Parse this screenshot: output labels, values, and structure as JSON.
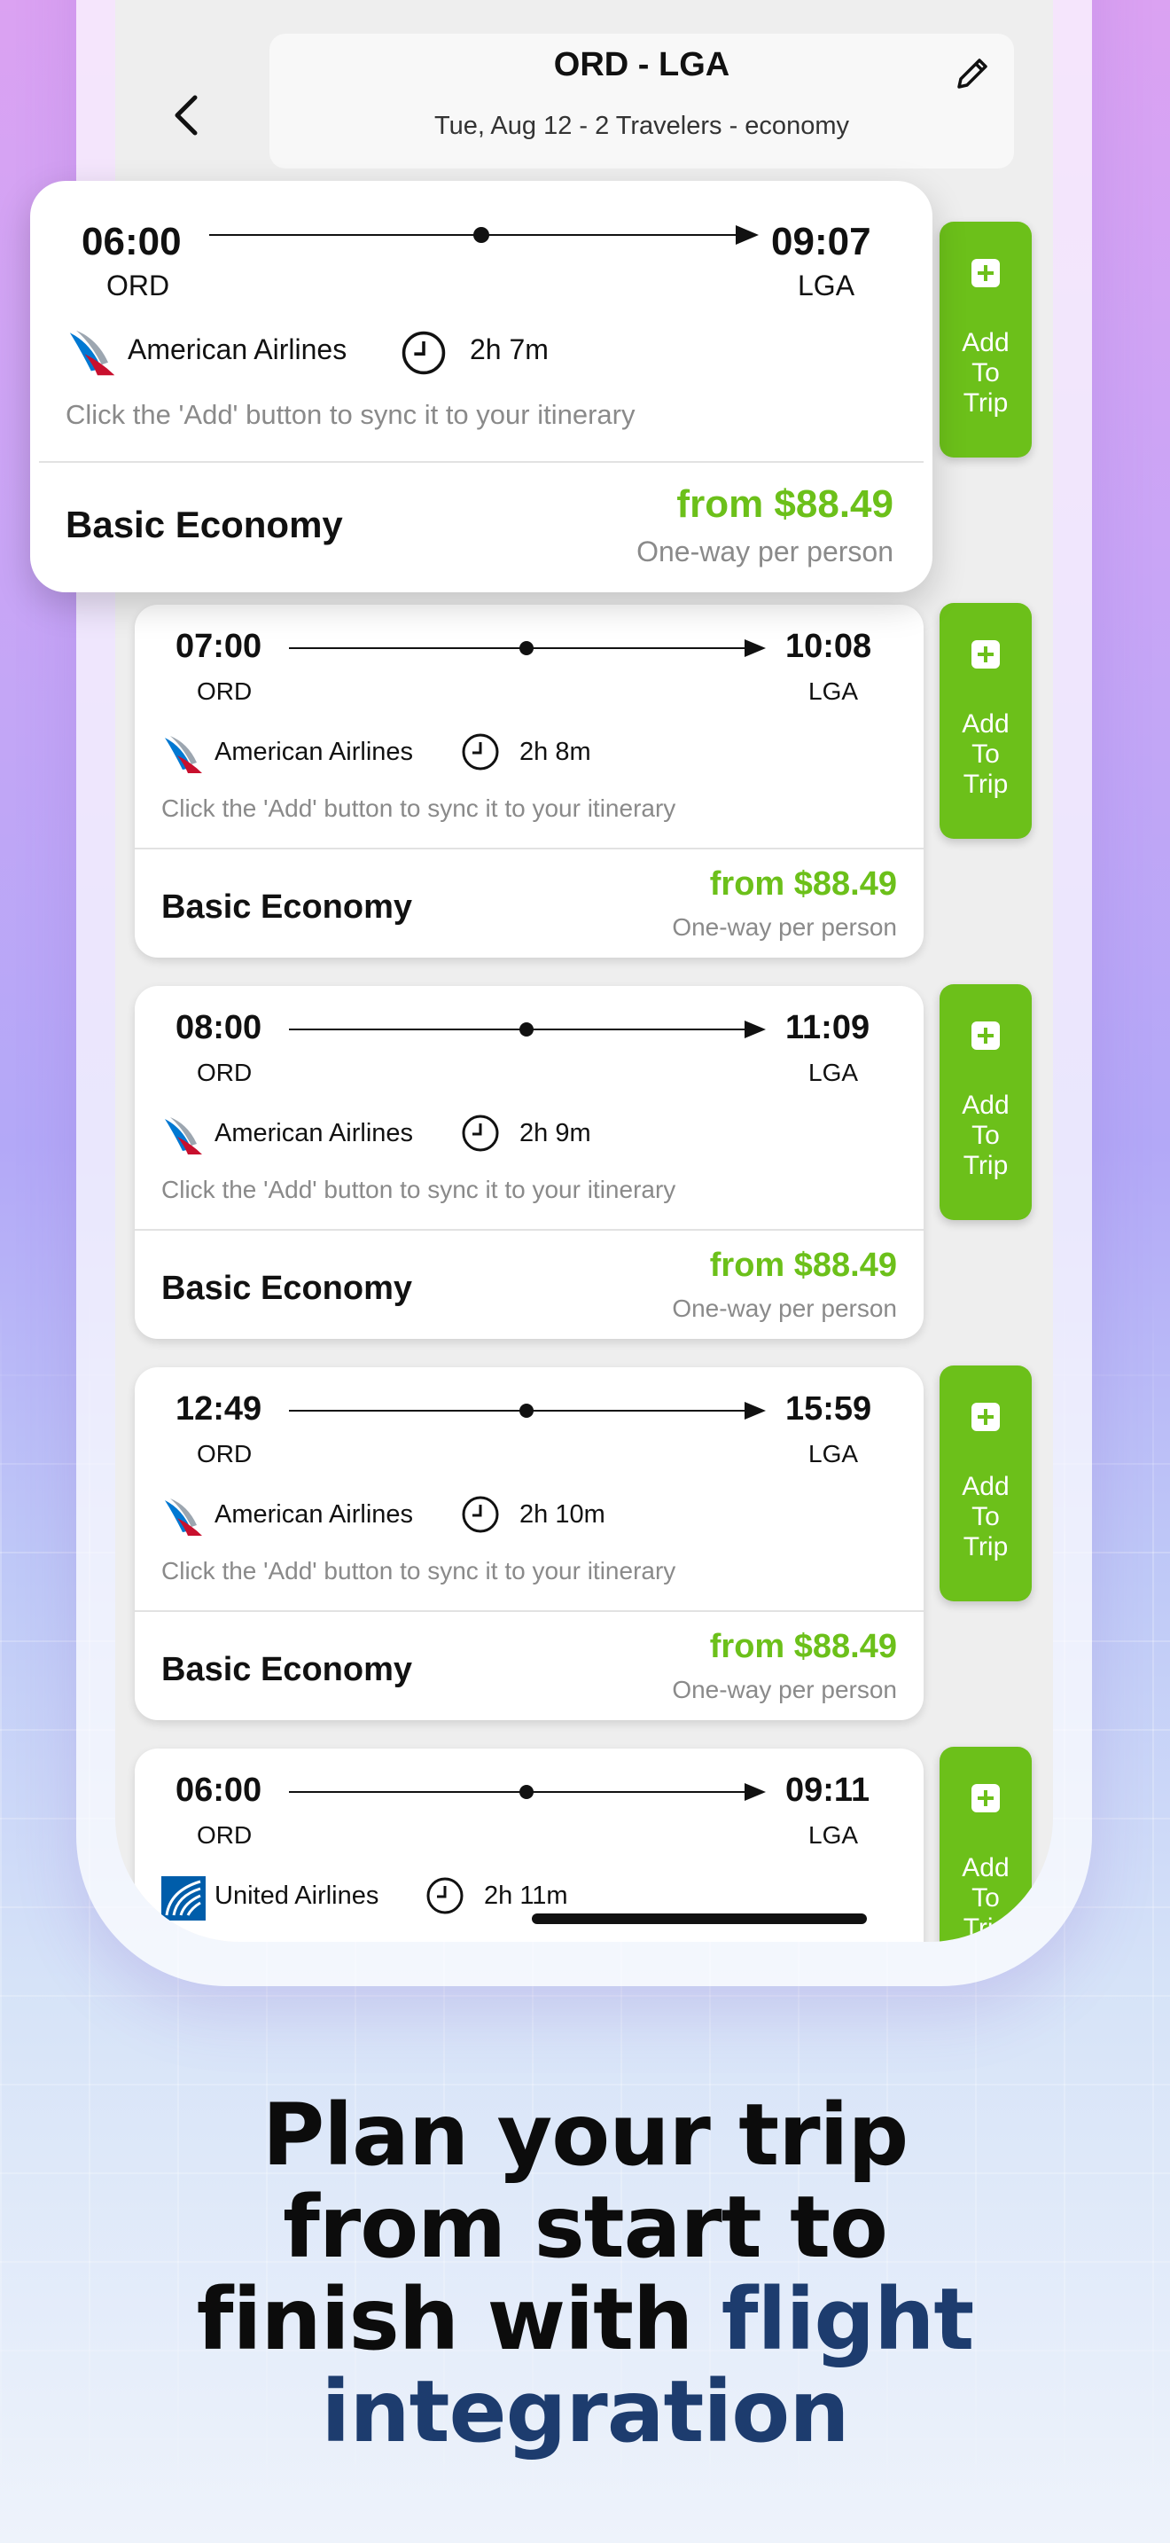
{
  "header": {
    "route": "ORD - LGA",
    "subtitle": "Tue, Aug 12 - 2 Travelers - economy"
  },
  "add_button": {
    "label": "Add\nTo\nTrip"
  },
  "flights": [
    {
      "dep_time": "06:00",
      "dep_code": "ORD",
      "arr_time": "09:07",
      "arr_code": "LGA",
      "airline": "American Airlines",
      "airline_logo": "american-airlines-logo",
      "duration": "2h 7m",
      "hint": "Click the 'Add' button to sync it to your itinerary",
      "fare": "Basic Economy",
      "price": "from $88.49",
      "price_note": "One-way per person"
    },
    {
      "dep_time": "07:00",
      "dep_code": "ORD",
      "arr_time": "10:08",
      "arr_code": "LGA",
      "airline": "American Airlines",
      "airline_logo": "american-airlines-logo",
      "duration": "2h 8m",
      "hint": "Click the 'Add' button to sync it to your itinerary",
      "fare": "Basic Economy",
      "price": "from $88.49",
      "price_note": "One-way per person"
    },
    {
      "dep_time": "08:00",
      "dep_code": "ORD",
      "arr_time": "11:09",
      "arr_code": "LGA",
      "airline": "American Airlines",
      "airline_logo": "american-airlines-logo",
      "duration": "2h 9m",
      "hint": "Click the 'Add' button to sync it to your itinerary",
      "fare": "Basic Economy",
      "price": "from $88.49",
      "price_note": "One-way per person"
    },
    {
      "dep_time": "12:49",
      "dep_code": "ORD",
      "arr_time": "15:59",
      "arr_code": "LGA",
      "airline": "American Airlines",
      "airline_logo": "american-airlines-logo",
      "duration": "2h 10m",
      "hint": "Click the 'Add' button to sync it to your itinerary",
      "fare": "Basic Economy",
      "price": "from $88.49",
      "price_note": "One-way per person"
    },
    {
      "dep_time": "06:00",
      "dep_code": "ORD",
      "arr_time": "09:11",
      "arr_code": "LGA",
      "airline": "United Airlines",
      "airline_logo": "united-airlines-logo",
      "duration": "2h 11m"
    }
  ],
  "headline": {
    "line1": "Plan your trip",
    "line2": "from start to",
    "line3_plain": "finish with ",
    "line3_accent": "flight",
    "line4": "integration"
  },
  "colors": {
    "accent_green": "#6cc01a",
    "headline_accent": "#1d3c6e",
    "aa_red": "#c8102e",
    "aa_blue": "#0078d2",
    "united_blue": "#005daa"
  }
}
